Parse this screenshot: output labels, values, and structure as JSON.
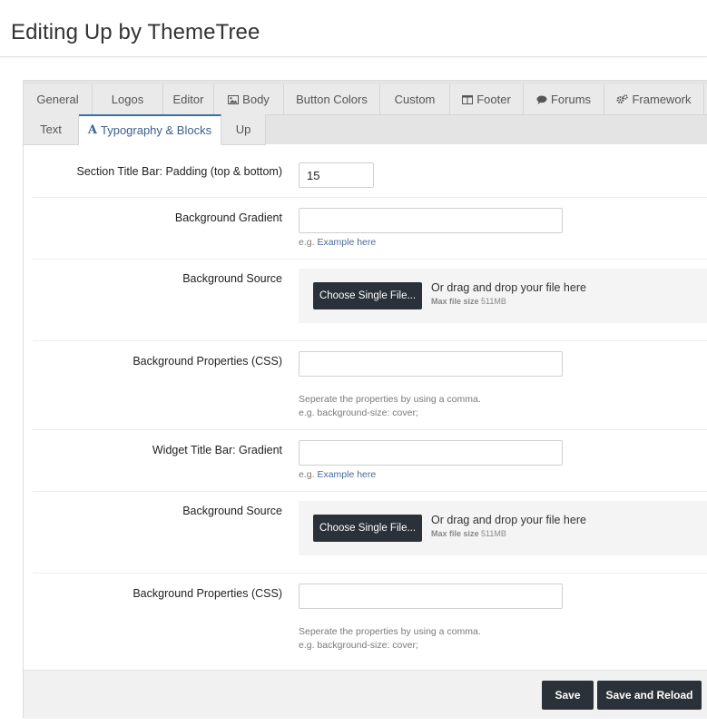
{
  "page": {
    "title": "Editing Up by ThemeTree"
  },
  "tabs": {
    "row1": [
      {
        "label": "General",
        "icon": ""
      },
      {
        "label": "Logos",
        "icon": ""
      },
      {
        "label": "Editor",
        "icon": ""
      },
      {
        "label": "Body",
        "icon": "image-icon"
      },
      {
        "label": "Button Colors",
        "icon": ""
      },
      {
        "label": "Custom",
        "icon": ""
      },
      {
        "label": "Footer",
        "icon": "columns-icon"
      },
      {
        "label": "Forums",
        "icon": "comment-icon"
      },
      {
        "label": "Framework",
        "icon": "gears-icon"
      }
    ],
    "row2": [
      {
        "label": "Text",
        "icon": ""
      },
      {
        "label": "Typography & Blocks",
        "icon": "font-icon",
        "glyph": "A",
        "active": true
      },
      {
        "label": "Up",
        "icon": ""
      }
    ]
  },
  "form": {
    "section_padding": {
      "label": "Section Title Bar: Padding (top & bottom)",
      "value": "15"
    },
    "bg_gradient": {
      "label": "Background Gradient",
      "value": "",
      "hint_prefix": "e.g.",
      "hint_link": "Example here"
    },
    "bg_source_1": {
      "label": "Background Source",
      "button": "Choose Single File...",
      "drop_text": "Or drag and drop your file here",
      "max_label": "Max file size",
      "max_value": "511MB"
    },
    "bg_props_1": {
      "label": "Background Properties (CSS)",
      "value": "",
      "hint_line1": "Seperate the properties by using a comma.",
      "hint_line2": "e.g. background-size: cover;"
    },
    "widget_gradient": {
      "label": "Widget Title Bar: Gradient",
      "value": "",
      "hint_prefix": "e.g.",
      "hint_link": "Example here"
    },
    "bg_source_2": {
      "label": "Background Source",
      "button": "Choose Single File...",
      "drop_text": "Or drag and drop your file here",
      "max_label": "Max file size",
      "max_value": "511MB"
    },
    "bg_props_2": {
      "label": "Background Properties (CSS)",
      "value": "",
      "hint_line1": "Seperate the properties by using a comma.",
      "hint_line2": "e.g. background-size: cover;"
    }
  },
  "footer": {
    "save_label": "Save",
    "save_reload_label": "Save and Reload"
  },
  "colors": {
    "accent": "#3a6ea5",
    "button_dark": "#2a3138",
    "tab_bg": "#eaeaea",
    "link": "#4a6a9a"
  }
}
